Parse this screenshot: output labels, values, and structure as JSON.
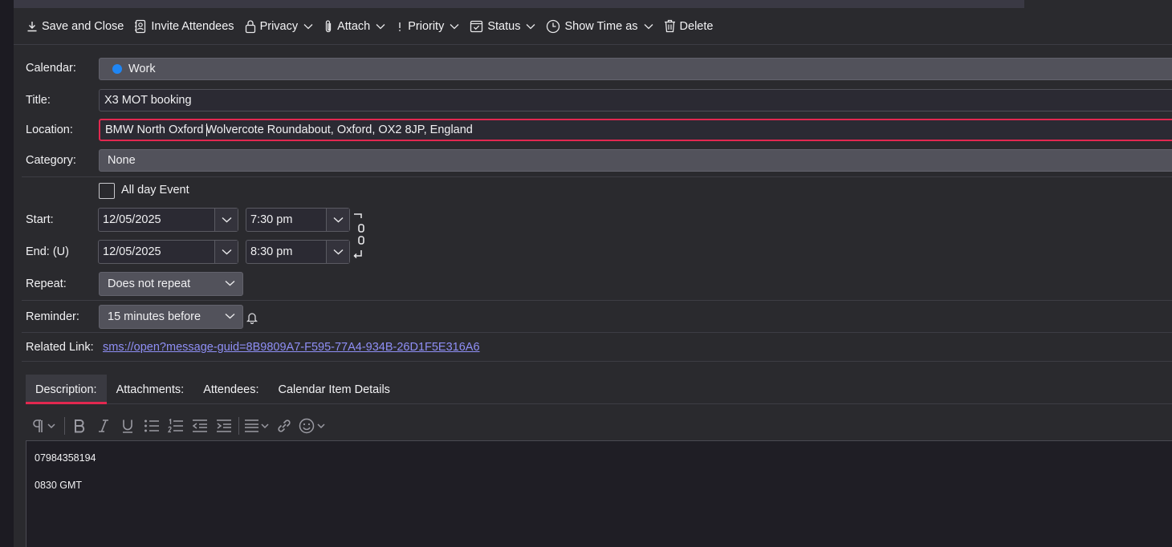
{
  "toolbar": {
    "save_close": "Save and Close",
    "invite": "Invite Attendees",
    "privacy": "Privacy",
    "attach": "Attach",
    "priority": "Priority",
    "status": "Status",
    "show_time_as": "Show Time as",
    "delete": "Delete"
  },
  "form": {
    "calendar_label": "Calendar:",
    "calendar_value": "Work",
    "calendar_color": "#1f86f5",
    "title_label": "Title:",
    "title_value": "X3 MOT booking",
    "location_label": "Location:",
    "location_value_a": "BMW North Oxford ",
    "location_value_b": "Wolvercote Roundabout, Oxford, OX2 8JP, England",
    "category_label": "Category:",
    "category_value": "None",
    "all_day_label": "All day Event",
    "all_day_checked": false,
    "start_label": "Start:",
    "start_date": "12/05/2025",
    "start_time": "7:30 pm",
    "end_label": "End: (U)",
    "end_date": "12/05/2025",
    "end_time": "8:30 pm",
    "repeat_label": "Repeat:",
    "repeat_value": "Does not repeat",
    "reminder_label": "Reminder:",
    "reminder_value": "15 minutes before",
    "related_label": "Related Link:",
    "related_value": "sms://open?message-guid=8B9809A7-F595-77A4-934B-26D1F5E316A6"
  },
  "tabs": [
    {
      "label": "Description:",
      "active": true
    },
    {
      "label": "Attachments:",
      "active": false
    },
    {
      "label": "Attendees:",
      "active": false
    },
    {
      "label": "Calendar Item Details",
      "active": false
    }
  ],
  "description": {
    "line1": "07984358194",
    "line2": "0830 GMT"
  },
  "colors": {
    "accent": "#e22850",
    "link": "#8f8ff6",
    "background": "#2a2a2e"
  }
}
